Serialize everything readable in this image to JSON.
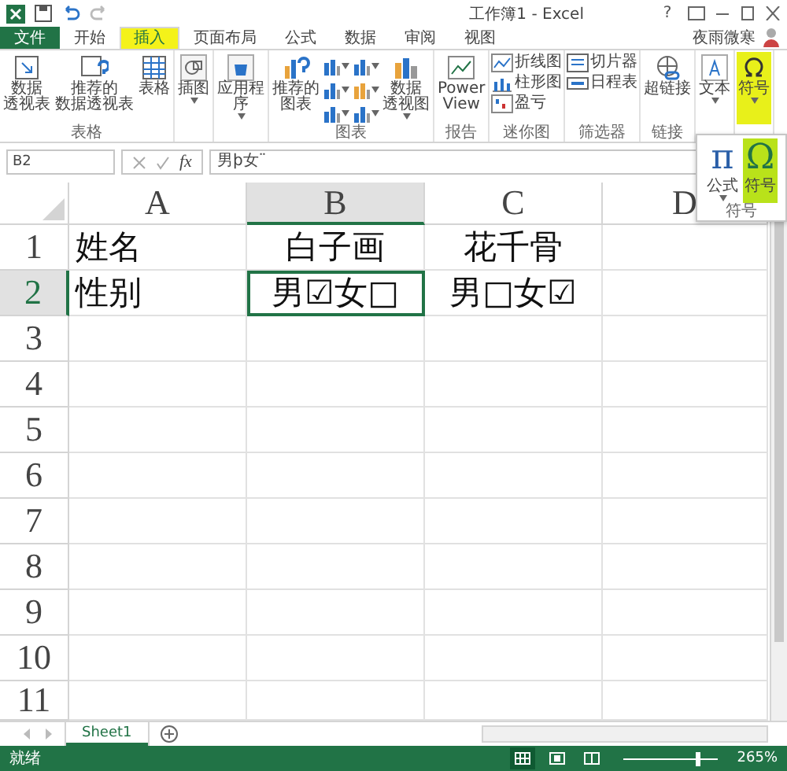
{
  "window": {
    "title": "工作簿1 - Excel",
    "help": "?",
    "user": "夜雨微寒"
  },
  "tabs": [
    {
      "label": "文件",
      "kind": "file",
      "selected": false,
      "highlighted": false
    },
    {
      "label": "开始",
      "kind": "tab",
      "selected": false,
      "highlighted": false
    },
    {
      "label": "插入",
      "kind": "tab",
      "selected": true,
      "highlighted": true
    },
    {
      "label": "页面布局",
      "kind": "tab",
      "selected": false,
      "highlighted": false
    },
    {
      "label": "公式",
      "kind": "tab",
      "selected": false,
      "highlighted": false
    },
    {
      "label": "数据",
      "kind": "tab",
      "selected": false,
      "highlighted": false
    },
    {
      "label": "审阅",
      "kind": "tab",
      "selected": false,
      "highlighted": false
    },
    {
      "label": "视图",
      "kind": "tab",
      "selected": false,
      "highlighted": false
    }
  ],
  "ribbon": {
    "groups": [
      {
        "label": "表格",
        "items": [
          {
            "kind": "pivot",
            "lines": [
              "数据",
              "透视表"
            ]
          },
          {
            "kind": "recommended-pivot",
            "lines": [
              "推荐的",
              "数据透视表"
            ]
          },
          {
            "kind": "table",
            "lines": [
              "表格"
            ]
          }
        ]
      },
      {
        "items": [
          {
            "kind": "illustration",
            "lines": [
              "插图"
            ],
            "dropdown": true
          }
        ]
      },
      {
        "items": [
          {
            "kind": "app",
            "lines": [
              "应用程",
              "序"
            ],
            "dropdown": true
          }
        ]
      },
      {
        "label": "图表",
        "items": [
          {
            "kind": "recommended-chart",
            "lines": [
              "推荐的",
              "图表"
            ]
          },
          {
            "kind": "chart-gallery"
          },
          {
            "kind": "pivot-chart",
            "lines": [
              "数据",
              "透视图"
            ],
            "dropdown": true
          }
        ]
      },
      {
        "label": "报告",
        "items": [
          {
            "kind": "power-view",
            "lines": [
              "Power",
              "View"
            ]
          }
        ]
      },
      {
        "label": "迷你图",
        "items": [
          {
            "kind": "sparkline-line",
            "lines": [
              "折线图"
            ]
          },
          {
            "kind": "sparkline-column",
            "lines": [
              "柱形图"
            ]
          },
          {
            "kind": "sparkline-winloss",
            "lines": [
              "盈亏"
            ]
          }
        ]
      },
      {
        "label": "筛选器",
        "items": [
          {
            "kind": "slicer",
            "lines": [
              "切片器"
            ]
          },
          {
            "kind": "timeline",
            "lines": [
              "日程表"
            ]
          }
        ]
      },
      {
        "label": "链接",
        "items": [
          {
            "kind": "hyperlink",
            "lines": [
              "超链接"
            ]
          }
        ]
      },
      {
        "items": [
          {
            "kind": "text",
            "lines": [
              "文本"
            ],
            "dropdown": true
          }
        ]
      },
      {
        "items": [
          {
            "kind": "symbol",
            "lines": [
              "符号"
            ],
            "dropdown": true,
            "highlighted": true
          }
        ]
      }
    ]
  },
  "popup": {
    "label": "符号",
    "items": [
      {
        "kind": "equation",
        "glyph": "π",
        "label": "公式",
        "dropdown": true,
        "highlighted": false
      },
      {
        "kind": "symbol",
        "glyph": "Ω",
        "label": "符号",
        "dropdown": false,
        "highlighted": true
      }
    ]
  },
  "formula_bar": {
    "name_box": "B2",
    "function_label": "fx",
    "value": "男þ女¨"
  },
  "grid": {
    "columns": [
      {
        "label": "A",
        "selected": false
      },
      {
        "label": "B",
        "selected": true
      },
      {
        "label": "C",
        "selected": false
      },
      {
        "label": "D",
        "selected": false
      }
    ],
    "rows": [
      {
        "label": "1",
        "selected": false,
        "cells": [
          {
            "text": "姓名",
            "active": false
          },
          {
            "text": "白子画",
            "active": false
          },
          {
            "text": "花千骨",
            "active": false
          }
        ]
      },
      {
        "label": "2",
        "selected": true,
        "cells": [
          {
            "text": "性别",
            "active": false
          },
          {
            "text": "男☑女□",
            "active": true
          },
          {
            "text": "男□女☑",
            "active": false
          }
        ]
      },
      {
        "label": "3",
        "selected": false
      },
      {
        "label": "4",
        "selected": false
      },
      {
        "label": "5",
        "selected": false
      },
      {
        "label": "6",
        "selected": false
      },
      {
        "label": "7",
        "selected": false
      },
      {
        "label": "8",
        "selected": false
      },
      {
        "label": "9",
        "selected": false
      },
      {
        "label": "10",
        "selected": false
      },
      {
        "label": "11",
        "selected": false
      }
    ]
  },
  "sheets": [
    {
      "label": "Sheet1",
      "selected": true
    }
  ],
  "status_bar": {
    "text": "就绪",
    "views": [
      {
        "kind": "normal",
        "selected": true
      },
      {
        "kind": "page-layout",
        "selected": false
      },
      {
        "kind": "page-break",
        "selected": false
      }
    ],
    "zoom_slider": {
      "level": 0.78
    },
    "zoom": "265%"
  }
}
